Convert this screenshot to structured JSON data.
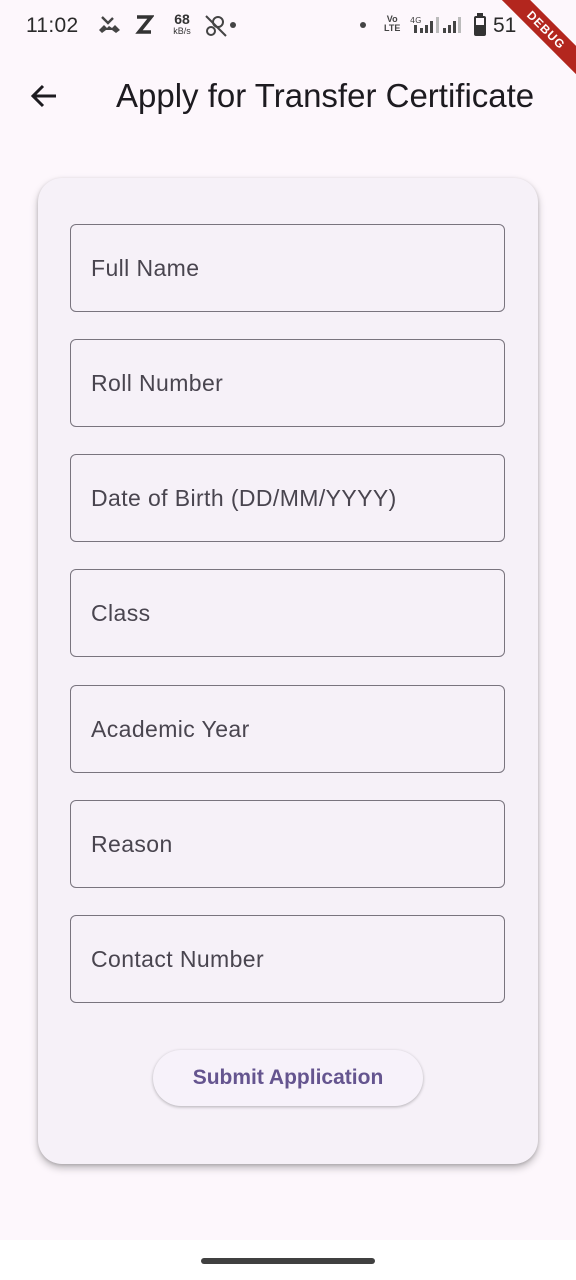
{
  "status_bar": {
    "time": "11:02",
    "network_speed_value": "68",
    "network_speed_unit": "kB/s",
    "volte_top": "Vo",
    "volte_bottom": "LTE",
    "signal_label": "4G",
    "battery_text": "51",
    "debug_label": "DEBUG"
  },
  "app_bar": {
    "title": "Apply for Transfer Certificate"
  },
  "form": {
    "fields": [
      {
        "placeholder": "Full Name",
        "value": ""
      },
      {
        "placeholder": "Roll Number",
        "value": ""
      },
      {
        "placeholder": "Date of Birth (DD/MM/YYYY)",
        "value": ""
      },
      {
        "placeholder": "Class",
        "value": ""
      },
      {
        "placeholder": "Academic Year",
        "value": ""
      },
      {
        "placeholder": "Reason",
        "value": ""
      },
      {
        "placeholder": "Contact Number",
        "value": ""
      }
    ],
    "submit_label": "Submit Application"
  },
  "colors": {
    "background": "#fdf7fc",
    "card": "#f6f1f8",
    "outline": "#79747e",
    "primary": "#65558f",
    "debug_ribbon": "#b3261e"
  },
  "icons": {
    "back": "arrow-back-icon",
    "missed_call": "missed-call-icon",
    "z_app": "z-app-icon",
    "gps_off": "location-off-icon",
    "signal": "signal-bars-icon",
    "battery": "battery-icon"
  }
}
